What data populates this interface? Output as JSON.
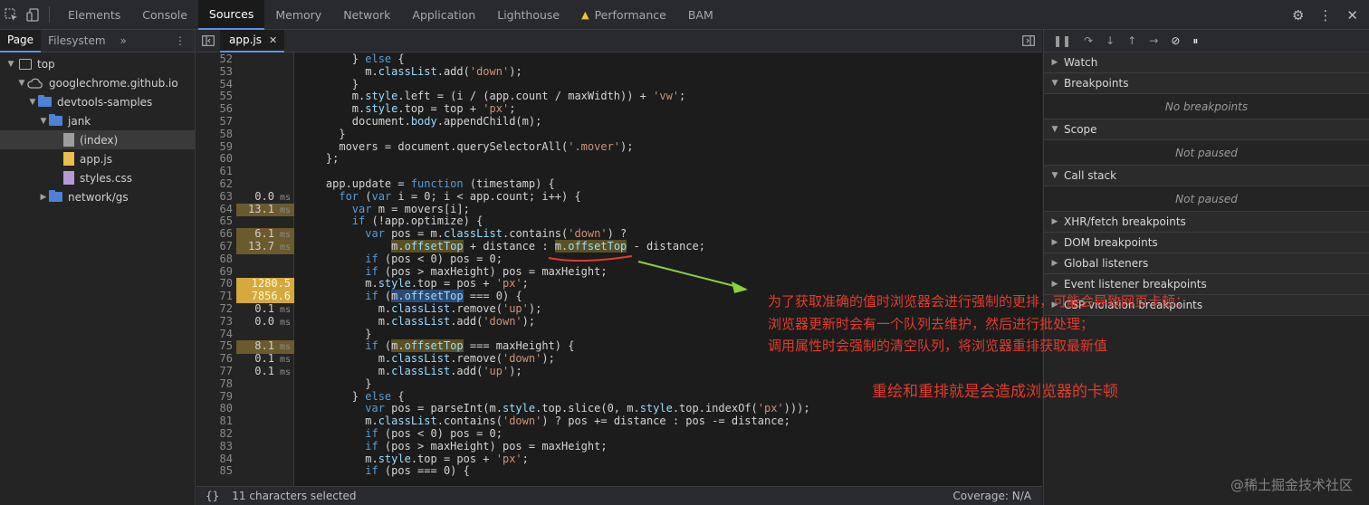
{
  "topbar": {
    "tabs": [
      "Elements",
      "Console",
      "Sources",
      "Memory",
      "Network",
      "Application",
      "Lighthouse",
      "Performance",
      "BAM"
    ],
    "active": "Sources"
  },
  "navigator": {
    "tabs": [
      "Page",
      "Filesystem"
    ],
    "more": "»",
    "tree": [
      "top",
      "googlechrome.github.io",
      "devtools-samples",
      "jank",
      "(index)",
      "app.js",
      "styles.css",
      "network/gs"
    ]
  },
  "editor": {
    "file_tab": "app.js",
    "lines": [
      {
        "n": "52",
        "t": "",
        "code": "        } else {"
      },
      {
        "n": "53",
        "t": "",
        "code": "          m.classList.add('down');"
      },
      {
        "n": "54",
        "t": "",
        "code": "        }"
      },
      {
        "n": "55",
        "t": "",
        "code": "        m.style.left = (i / (app.count / maxWidth)) + 'vw';"
      },
      {
        "n": "56",
        "t": "",
        "code": "        m.style.top = top + 'px';"
      },
      {
        "n": "57",
        "t": "",
        "code": "        document.body.appendChild(m);"
      },
      {
        "n": "58",
        "t": "",
        "code": "      }"
      },
      {
        "n": "59",
        "t": "",
        "code": "      movers = document.querySelectorAll('.mover');"
      },
      {
        "n": "60",
        "t": "",
        "code": "    };"
      },
      {
        "n": "61",
        "t": "",
        "code": ""
      },
      {
        "n": "62",
        "t": "",
        "code": "    app.update = function (timestamp) {"
      },
      {
        "n": "63",
        "t": "0.0",
        "code": "      for (var i = 0; i < app.count; i++) {"
      },
      {
        "n": "64",
        "t": "13.1",
        "code": "        var m = movers[i];"
      },
      {
        "n": "65",
        "t": "",
        "code": "        if (!app.optimize) {"
      },
      {
        "n": "66",
        "t": "6.1",
        "code": "          var pos = m.classList.contains('down') ?"
      },
      {
        "n": "67",
        "t": "13.7",
        "code": "              m.offsetTop + distance : m.offsetTop - distance;"
      },
      {
        "n": "68",
        "t": "",
        "code": "          if (pos < 0) pos = 0;"
      },
      {
        "n": "69",
        "t": "",
        "code": "          if (pos > maxHeight) pos = maxHeight;"
      },
      {
        "n": "70",
        "t": "1280.5",
        "code": "          m.style.top = pos + 'px';"
      },
      {
        "n": "71",
        "t": "7856.6",
        "code": "          if (m.offsetTop === 0) {"
      },
      {
        "n": "72",
        "t": "0.1",
        "code": "            m.classList.remove('up');"
      },
      {
        "n": "73",
        "t": "0.0",
        "code": "            m.classList.add('down');"
      },
      {
        "n": "74",
        "t": "",
        "code": "          }"
      },
      {
        "n": "75",
        "t": "8.1",
        "code": "          if (m.offsetTop === maxHeight) {"
      },
      {
        "n": "76",
        "t": "0.1",
        "code": "            m.classList.remove('down');"
      },
      {
        "n": "77",
        "t": "0.1",
        "code": "            m.classList.add('up');"
      },
      {
        "n": "78",
        "t": "",
        "code": "          }"
      },
      {
        "n": "79",
        "t": "",
        "code": "        } else {"
      },
      {
        "n": "80",
        "t": "",
        "code": "          var pos = parseInt(m.style.top.slice(0, m.style.top.indexOf('px')));"
      },
      {
        "n": "81",
        "t": "",
        "code": "          m.classList.contains('down') ? pos += distance : pos -= distance;"
      },
      {
        "n": "82",
        "t": "",
        "code": "          if (pos < 0) pos = 0;"
      },
      {
        "n": "83",
        "t": "",
        "code": "          if (pos > maxHeight) pos = maxHeight;"
      },
      {
        "n": "84",
        "t": "",
        "code": "          m.style.top = pos + 'px';"
      },
      {
        "n": "85",
        "t": "",
        "code": "          if (pos === 0) {"
      }
    ],
    "ms_unit": "ms",
    "status_selected": "11 characters selected",
    "status_coverage": "Coverage: N/A",
    "status_braces": "{}"
  },
  "debugger": {
    "sections": [
      {
        "label": "Watch",
        "body": ""
      },
      {
        "label": "Breakpoints",
        "body": "No breakpoints"
      },
      {
        "label": "Scope",
        "body": "Not paused"
      },
      {
        "label": "Call stack",
        "body": "Not paused"
      },
      {
        "label": "XHR/fetch breakpoints",
        "body": ""
      },
      {
        "label": "DOM breakpoints",
        "body": ""
      },
      {
        "label": "Global listeners",
        "body": ""
      },
      {
        "label": "Event listener breakpoints",
        "body": ""
      },
      {
        "label": "CSP violation breakpoints",
        "body": ""
      }
    ]
  },
  "annotations": {
    "line1": "为了获取准确的值时浏览器会进行强制的更排，可能会导致网页卡顿；",
    "line2": "浏览器更新时会有一个队列去维护，然后进行批处理；",
    "line3": "调用属性时会强制的清空队列，将浏览器重排获取最新值",
    "line4": "重绘和重排就是会造成浏览器的卡顿"
  },
  "watermark": "@稀土掘金技术社区",
  "colors": {
    "accent": "#5c93e6",
    "annotation": "#e23b2e",
    "arrow": "#8bd23b",
    "hot": "#d4aa3e",
    "warm": "#6b5a2e"
  }
}
